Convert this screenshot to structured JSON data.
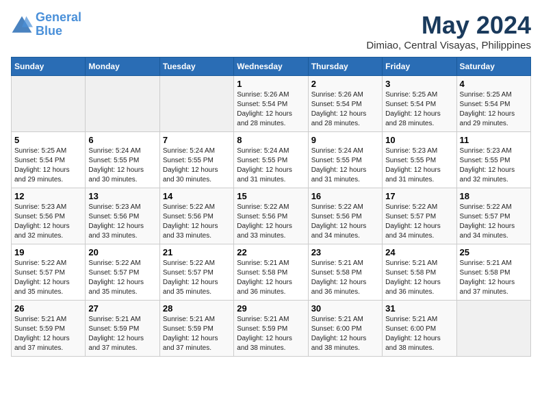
{
  "header": {
    "logo_line1": "General",
    "logo_line2": "Blue",
    "month": "May 2024",
    "location": "Dimiao, Central Visayas, Philippines"
  },
  "weekdays": [
    "Sunday",
    "Monday",
    "Tuesday",
    "Wednesday",
    "Thursday",
    "Friday",
    "Saturday"
  ],
  "weeks": [
    [
      {
        "date": "",
        "info": ""
      },
      {
        "date": "",
        "info": ""
      },
      {
        "date": "",
        "info": ""
      },
      {
        "date": "1",
        "info": "Sunrise: 5:26 AM\nSunset: 5:54 PM\nDaylight: 12 hours\nand 28 minutes."
      },
      {
        "date": "2",
        "info": "Sunrise: 5:26 AM\nSunset: 5:54 PM\nDaylight: 12 hours\nand 28 minutes."
      },
      {
        "date": "3",
        "info": "Sunrise: 5:25 AM\nSunset: 5:54 PM\nDaylight: 12 hours\nand 28 minutes."
      },
      {
        "date": "4",
        "info": "Sunrise: 5:25 AM\nSunset: 5:54 PM\nDaylight: 12 hours\nand 29 minutes."
      }
    ],
    [
      {
        "date": "5",
        "info": "Sunrise: 5:25 AM\nSunset: 5:54 PM\nDaylight: 12 hours\nand 29 minutes."
      },
      {
        "date": "6",
        "info": "Sunrise: 5:24 AM\nSunset: 5:55 PM\nDaylight: 12 hours\nand 30 minutes."
      },
      {
        "date": "7",
        "info": "Sunrise: 5:24 AM\nSunset: 5:55 PM\nDaylight: 12 hours\nand 30 minutes."
      },
      {
        "date": "8",
        "info": "Sunrise: 5:24 AM\nSunset: 5:55 PM\nDaylight: 12 hours\nand 31 minutes."
      },
      {
        "date": "9",
        "info": "Sunrise: 5:24 AM\nSunset: 5:55 PM\nDaylight: 12 hours\nand 31 minutes."
      },
      {
        "date": "10",
        "info": "Sunrise: 5:23 AM\nSunset: 5:55 PM\nDaylight: 12 hours\nand 31 minutes."
      },
      {
        "date": "11",
        "info": "Sunrise: 5:23 AM\nSunset: 5:55 PM\nDaylight: 12 hours\nand 32 minutes."
      }
    ],
    [
      {
        "date": "12",
        "info": "Sunrise: 5:23 AM\nSunset: 5:56 PM\nDaylight: 12 hours\nand 32 minutes."
      },
      {
        "date": "13",
        "info": "Sunrise: 5:23 AM\nSunset: 5:56 PM\nDaylight: 12 hours\nand 33 minutes."
      },
      {
        "date": "14",
        "info": "Sunrise: 5:22 AM\nSunset: 5:56 PM\nDaylight: 12 hours\nand 33 minutes."
      },
      {
        "date": "15",
        "info": "Sunrise: 5:22 AM\nSunset: 5:56 PM\nDaylight: 12 hours\nand 33 minutes."
      },
      {
        "date": "16",
        "info": "Sunrise: 5:22 AM\nSunset: 5:56 PM\nDaylight: 12 hours\nand 34 minutes."
      },
      {
        "date": "17",
        "info": "Sunrise: 5:22 AM\nSunset: 5:57 PM\nDaylight: 12 hours\nand 34 minutes."
      },
      {
        "date": "18",
        "info": "Sunrise: 5:22 AM\nSunset: 5:57 PM\nDaylight: 12 hours\nand 34 minutes."
      }
    ],
    [
      {
        "date": "19",
        "info": "Sunrise: 5:22 AM\nSunset: 5:57 PM\nDaylight: 12 hours\nand 35 minutes."
      },
      {
        "date": "20",
        "info": "Sunrise: 5:22 AM\nSunset: 5:57 PM\nDaylight: 12 hours\nand 35 minutes."
      },
      {
        "date": "21",
        "info": "Sunrise: 5:22 AM\nSunset: 5:57 PM\nDaylight: 12 hours\nand 35 minutes."
      },
      {
        "date": "22",
        "info": "Sunrise: 5:21 AM\nSunset: 5:58 PM\nDaylight: 12 hours\nand 36 minutes."
      },
      {
        "date": "23",
        "info": "Sunrise: 5:21 AM\nSunset: 5:58 PM\nDaylight: 12 hours\nand 36 minutes."
      },
      {
        "date": "24",
        "info": "Sunrise: 5:21 AM\nSunset: 5:58 PM\nDaylight: 12 hours\nand 36 minutes."
      },
      {
        "date": "25",
        "info": "Sunrise: 5:21 AM\nSunset: 5:58 PM\nDaylight: 12 hours\nand 37 minutes."
      }
    ],
    [
      {
        "date": "26",
        "info": "Sunrise: 5:21 AM\nSunset: 5:59 PM\nDaylight: 12 hours\nand 37 minutes."
      },
      {
        "date": "27",
        "info": "Sunrise: 5:21 AM\nSunset: 5:59 PM\nDaylight: 12 hours\nand 37 minutes."
      },
      {
        "date": "28",
        "info": "Sunrise: 5:21 AM\nSunset: 5:59 PM\nDaylight: 12 hours\nand 37 minutes."
      },
      {
        "date": "29",
        "info": "Sunrise: 5:21 AM\nSunset: 5:59 PM\nDaylight: 12 hours\nand 38 minutes."
      },
      {
        "date": "30",
        "info": "Sunrise: 5:21 AM\nSunset: 6:00 PM\nDaylight: 12 hours\nand 38 minutes."
      },
      {
        "date": "31",
        "info": "Sunrise: 5:21 AM\nSunset: 6:00 PM\nDaylight: 12 hours\nand 38 minutes."
      },
      {
        "date": "",
        "info": ""
      }
    ]
  ]
}
